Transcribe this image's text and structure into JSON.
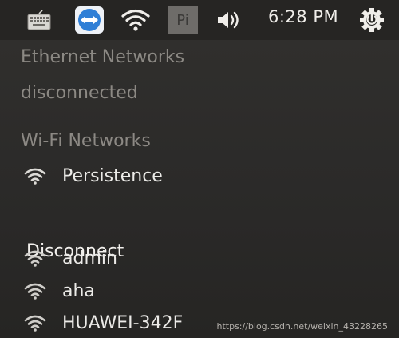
{
  "topbar": {
    "icons": [
      "keyboard-icon",
      "teamviewer-icon",
      "wifi-icon",
      "pi-icon",
      "volume-icon",
      "power-icon"
    ],
    "pi_label": "Pi",
    "clock": "6:28 PM",
    "colors": {
      "teamviewer_blue": "#2f7fd6",
      "bar": "#262523"
    }
  },
  "menu": {
    "ethernet_header": "Ethernet Networks",
    "ethernet_status": "disconnected",
    "wifi_header": "Wi-Fi Networks",
    "connected_network": "Persistence",
    "disconnect_label": "Disconnect",
    "networks": [
      "admin",
      "aha",
      "HUAWEI-342F"
    ]
  },
  "watermark": "https://blog.csdn.net/weixin_43228265"
}
